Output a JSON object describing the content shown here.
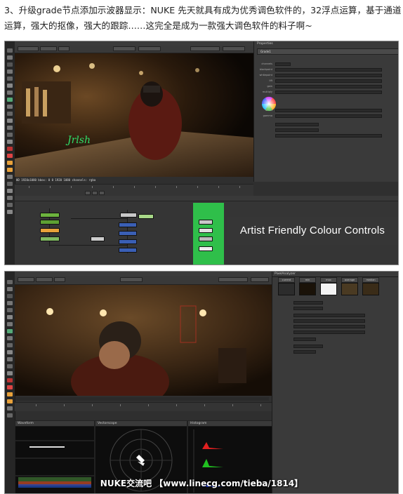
{
  "intro_text": "3、升级grade节点添加示波器显示：NUKE 先天就具有成为优秀调色软件的，32浮点运算，基于通道运算，强大的抠像，强大的跟踪……这完全是成为一款强大调色软件的料子啊~",
  "screenshot1": {
    "viewer_format": "HD 1920x1080 bbox: 0 0 1920 1080 channels: rgba",
    "properties_title": "Properties",
    "grade_node": "Grade1",
    "param_labels": [
      "channels",
      "blackpoint",
      "whitepoint",
      "lift",
      "gain",
      "multiply",
      "offset",
      "gamma"
    ],
    "banner": "Artist Friendly Colour Controls",
    "colors": {
      "panel": "#2f2f2f",
      "accent_orange": "#e8a13a",
      "node_green": "#6cb33e",
      "node_blue": "#3a5fb5"
    }
  },
  "screenshot2": {
    "scope_panels": [
      "Waveform",
      "Vectorscope",
      "Histogram"
    ],
    "picker_tab": "PixelAnalyzer",
    "swatch_labels": [
      "current",
      "min",
      "max",
      "average",
      "median"
    ],
    "watermark": "NUKE交流吧 【www.linecg.com/tieba/1814】"
  }
}
